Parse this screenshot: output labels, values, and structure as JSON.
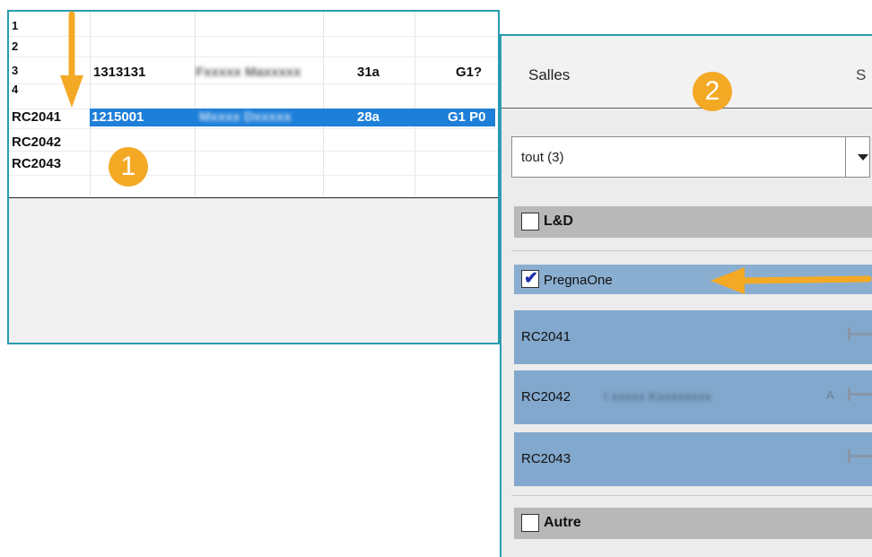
{
  "spreadsheet": {
    "row_numbers": [
      "1",
      "2",
      "3",
      "4"
    ],
    "row3": {
      "id": "1313131",
      "name": "Fxxxxx Maxxxxx",
      "age": "31a",
      "code": "G1?"
    },
    "selected_row": {
      "label": "RC2041",
      "id": "1215001",
      "name": "Mxxxx Dxxxxx",
      "age": "28a",
      "code": "G1 P0"
    },
    "room_labels": [
      "RC2042",
      "RC2043"
    ]
  },
  "panel": {
    "title": "Salles",
    "tail_char": "S",
    "combo_value": "tout (3)",
    "groups": [
      {
        "label": "L&D",
        "checked": false
      },
      {
        "label": "Autre",
        "checked": false
      }
    ],
    "pregna": {
      "label": "PregnaOne",
      "checked": true
    },
    "rooms": [
      {
        "name": "RC2041",
        "patient": "",
        "warning": ""
      },
      {
        "name": "RC2042",
        "patient": "I xxxxx Kxxxxxxxx",
        "warning": "A"
      },
      {
        "name": "RC2043",
        "patient": "",
        "warning": ""
      }
    ]
  },
  "annotations": {
    "badge1": "1",
    "badge2": "2",
    "color": "#f4a925"
  }
}
